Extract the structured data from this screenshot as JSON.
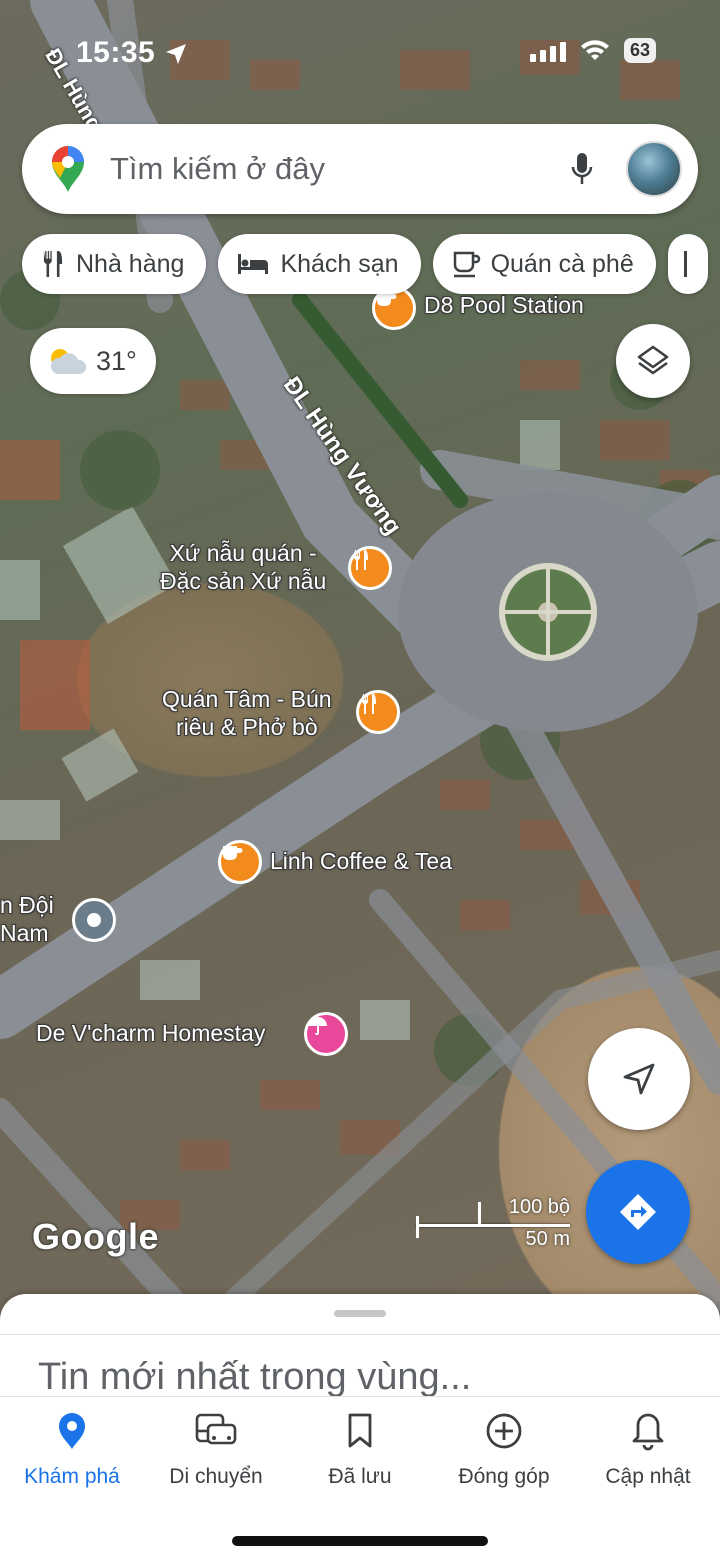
{
  "status_bar": {
    "time": "15:35",
    "battery": "63"
  },
  "search": {
    "placeholder": "Tìm kiếm ở đây"
  },
  "chips": [
    {
      "label": "Nhà hàng",
      "icon": "restaurant-icon"
    },
    {
      "label": "Khách sạn",
      "icon": "hotel-icon"
    },
    {
      "label": "Quán cà phê",
      "icon": "coffee-icon"
    }
  ],
  "weather": {
    "temperature": "31°",
    "icon": "partly-cloudy-icon"
  },
  "map": {
    "road_labels": [
      "ĐL Hùng Vương",
      "ĐL Hùng Vương"
    ],
    "places": [
      {
        "name": "D8 Pool Station",
        "type": "cafe"
      },
      {
        "name_line1": "Xứ nẫu quán -",
        "name_line2": "Đặc sản Xứ nẫu",
        "type": "restaurant"
      },
      {
        "name_line1": "Quán Tâm - Bún",
        "name_line2": "riêu & Phở bò",
        "type": "restaurant"
      },
      {
        "name": "Linh Coffee & Tea",
        "type": "cafe"
      },
      {
        "name_line1": "n Đội",
        "name_line2": "Nam",
        "type": "landmark"
      },
      {
        "name": "De V'charm Homestay",
        "type": "hotel"
      }
    ],
    "attribution": "Google",
    "scale": {
      "imperial": "100 bộ",
      "metric": "50 m"
    }
  },
  "sheet": {
    "title": "Tin mới nhất trong vùng..."
  },
  "bottom_nav": [
    {
      "label": "Khám phá",
      "icon": "explore-pin-icon",
      "active": true
    },
    {
      "label": "Di chuyển",
      "icon": "commute-icon",
      "active": false
    },
    {
      "label": "Đã lưu",
      "icon": "bookmark-icon",
      "active": false
    },
    {
      "label": "Đóng góp",
      "icon": "add-circle-icon",
      "active": false
    },
    {
      "label": "Cập nhật",
      "icon": "bell-icon",
      "active": false
    }
  ],
  "colors": {
    "accent": "#1a73e8",
    "pin_orange": "#f28a1c",
    "pin_pink": "#e8479a"
  }
}
